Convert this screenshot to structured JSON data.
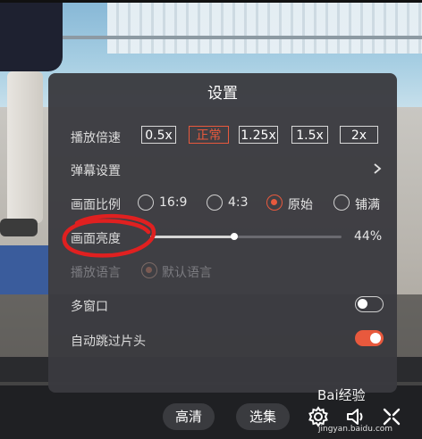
{
  "panel": {
    "title": "设置",
    "playback_speed": {
      "label": "播放倍速",
      "options": [
        "0.5x",
        "正常",
        "1.25x",
        "1.5x",
        "2x"
      ],
      "selected": "正常"
    },
    "danmaku": {
      "label": "弹幕设置"
    },
    "aspect_ratio": {
      "label": "画面比例",
      "options": [
        "16:9",
        "4:3",
        "原始",
        "铺满"
      ],
      "selected": "原始"
    },
    "brightness": {
      "label": "画面亮度",
      "value_text": "44%",
      "level": 0.44
    },
    "language": {
      "label": "播放语言",
      "option": "默认语言",
      "enabled": false
    },
    "multi_window": {
      "label": "多窗口",
      "on": false
    },
    "skip_intro": {
      "label": "自动跳过片头",
      "on": true
    }
  },
  "controls": {
    "quality_label": "高清",
    "episodes_label": "选集",
    "icons": [
      "gear-icon",
      "volume-icon",
      "fullscreen-icon"
    ]
  },
  "watermark": {
    "text": "Bai经验",
    "url": "jingyan.baidu.com"
  },
  "colors": {
    "accent": "#e8593d",
    "panel_bg": "#3a3a40",
    "annotation": "#e02020"
  }
}
